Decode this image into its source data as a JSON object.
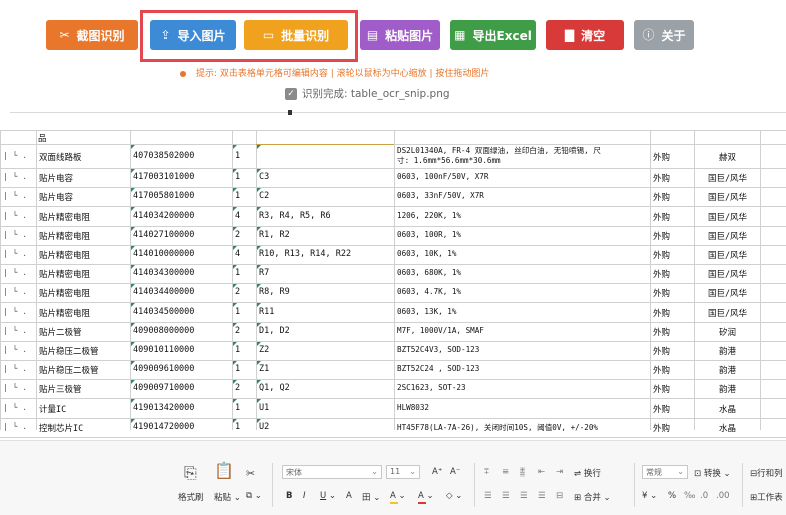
{
  "toolbar": {
    "buttons": [
      {
        "id": "screenshot",
        "icon": "scissors-icon",
        "glyph": "✂",
        "label": "截图识别",
        "color": "#e8762b"
      },
      {
        "id": "import",
        "icon": "upload-icon",
        "glyph": "⇪",
        "label": "导入图片",
        "color": "#3d8bd6"
      },
      {
        "id": "batch",
        "icon": "frame-icon",
        "glyph": "▭",
        "label": "批量识别",
        "color": "#f0a11e"
      },
      {
        "id": "paste",
        "icon": "clipboard-icon",
        "glyph": "▤",
        "label": "粘贴图片",
        "color": "#a05cc8"
      },
      {
        "id": "export",
        "icon": "excel-icon",
        "glyph": "▦",
        "label": "导出Excel",
        "color": "#3f9c47"
      },
      {
        "id": "clear",
        "icon": "trash-icon",
        "glyph": "▇",
        "label": "清空",
        "color": "#d83a3a"
      },
      {
        "id": "about",
        "icon": "info-icon",
        "glyph": "ⓘ",
        "label": "关于",
        "color": "#9aa2a8"
      }
    ],
    "tip": "提示: 双击表格单元格可编辑内容 | 滚轮以鼠标为中心缩放 | 按住拖动图片",
    "status": "识别完成: table_ocr_snip.png"
  },
  "table": {
    "header_fragment": "品",
    "tree_marker": "| └ .",
    "rows": [
      {
        "name": "双面线路板",
        "code": "407038502000",
        "qty": "1",
        "ref": "",
        "spec": [
          "DS2L01340A, FR-4 双面绿油, 丝印白油, 无铅喷锡, 尺",
          "寸: 1.6mm*56.6mm*30.6mm"
        ],
        "source": "外购",
        "brand": "赫双"
      },
      {
        "name": "贴片电容",
        "code": "417003101000",
        "qty": "1",
        "ref": "C3",
        "spec": [
          "0603, 100nF/50V, X7R"
        ],
        "source": "外购",
        "brand": "国巨/风华"
      },
      {
        "name": "贴片电容",
        "code": "417005801000",
        "qty": "1",
        "ref": "C2",
        "spec": [
          "0603, 33nF/50V, X7R"
        ],
        "source": "外购",
        "brand": "国巨/风华"
      },
      {
        "name": "贴片精密电阻",
        "code": "414034200000",
        "qty": "4",
        "ref": "R3, R4, R5, R6",
        "spec": [
          "1206, 220K, 1%"
        ],
        "source": "外购",
        "brand": "国巨/风华"
      },
      {
        "name": "贴片精密电阻",
        "code": "414027100000",
        "qty": "2",
        "ref": "R1, R2",
        "spec": [
          "0603, 100R, 1%"
        ],
        "source": "外购",
        "brand": "国巨/风华"
      },
      {
        "name": "贴片精密电阻",
        "code": "414010000000",
        "qty": "4",
        "ref": "R10, R13, R14, R22",
        "spec": [
          "0603, 10K, 1%"
        ],
        "source": "外购",
        "brand": "国巨/风华"
      },
      {
        "name": "贴片精密电阻",
        "code": "414034300000",
        "qty": "1",
        "ref": "R7",
        "spec": [
          "0603, 680K, 1%"
        ],
        "source": "外购",
        "brand": "国巨/风华"
      },
      {
        "name": "贴片精密电阻",
        "code": "414034400000",
        "qty": "2",
        "ref": "R8, R9",
        "spec": [
          "0603, 4.7K, 1%"
        ],
        "source": "外购",
        "brand": "国巨/风华"
      },
      {
        "name": "贴片精密电阻",
        "code": "414034500000",
        "qty": "1",
        "ref": "R11",
        "spec": [
          "0603, 13K, 1%"
        ],
        "source": "外购",
        "brand": "国巨/风华"
      },
      {
        "name": "贴片二极管",
        "code": "409008000000",
        "qty": "2",
        "ref": "D1, D2",
        "spec": [
          "M7F, 1000V/1A, SMAF"
        ],
        "source": "外购",
        "brand": "矽润"
      },
      {
        "name": "贴片稳压二极管",
        "code": "409010110000",
        "qty": "1",
        "ref": "Z2",
        "spec": [
          "BZT52C4V3, SOD-123"
        ],
        "source": "外购",
        "brand": "韵港"
      },
      {
        "name": "贴片稳压二极管",
        "code": "409009610000",
        "qty": "1",
        "ref": "Z1",
        "spec": [
          "BZT52C24 , SOD-123"
        ],
        "source": "外购",
        "brand": "韵港"
      },
      {
        "name": "贴片三极管",
        "code": "409009710000",
        "qty": "2",
        "ref": "Q1, Q2",
        "spec": [
          "2SC1623, SOT-23"
        ],
        "source": "外购",
        "brand": "韵港"
      },
      {
        "name": "计量IC",
        "code": "419013420000",
        "qty": "1",
        "ref": "U1",
        "spec": [
          "HLW8032"
        ],
        "source": "外购",
        "brand": "水晶"
      },
      {
        "name": "控制芯片IC",
        "code": "419014720000",
        "qty": "1",
        "ref": "U2",
        "spec": [
          "HT45F78(LA-7A-26), 关闭时间10S, 阈值0V, +/-20%"
        ],
        "source": "外购",
        "brand": "水晶"
      }
    ]
  },
  "ribbon": {
    "format_painter": "格式刷",
    "paste": "粘贴",
    "cut_icon": "✂",
    "font_name": "宋体",
    "font_size": "11",
    "grow_font": "A⁺",
    "shrink_font": "A⁻",
    "bold": "B",
    "italic": "I",
    "underline": "U",
    "strike": "A",
    "border": "田",
    "fill": "A",
    "font_color": "A",
    "clear": "◇",
    "wrap": "换行",
    "merge": "合并",
    "number_format": "常规",
    "convert": "转换",
    "currency": "¥",
    "percent": "%",
    "rows_cols": "行和列",
    "worksheet": "工作表",
    "fill_color": "#f1c232",
    "font_color_bar": "#d83a3a"
  }
}
